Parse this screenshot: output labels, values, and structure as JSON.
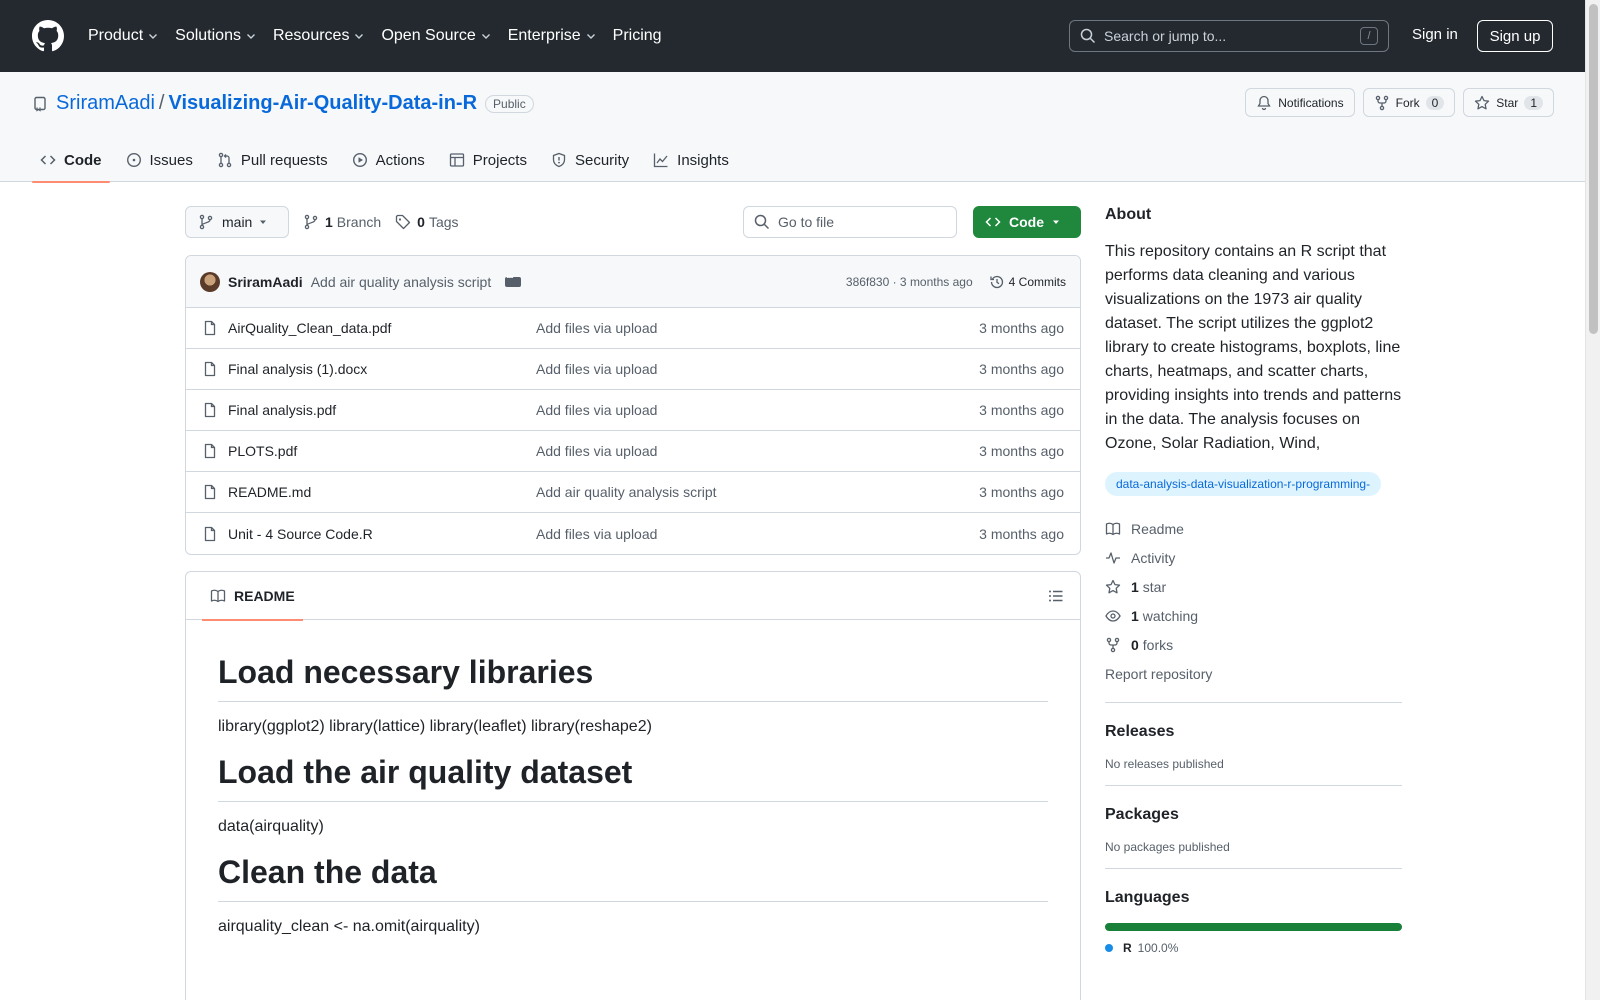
{
  "header": {
    "nav": [
      {
        "label": "Product",
        "has_menu": true
      },
      {
        "label": "Solutions",
        "has_menu": true
      },
      {
        "label": "Resources",
        "has_menu": true
      },
      {
        "label": "Open Source",
        "has_menu": true
      },
      {
        "label": "Enterprise",
        "has_menu": true
      },
      {
        "label": "Pricing",
        "has_menu": false
      }
    ],
    "search_placeholder": "Search or jump to...",
    "search_shortcut": "/",
    "sign_in": "Sign in",
    "sign_up": "Sign up"
  },
  "repo": {
    "owner": "SriramAadi",
    "separator": "/",
    "name": "Visualizing-Air-Quality-Data-in-R",
    "visibility": "Public",
    "notifications_label": "Notifications",
    "fork_label": "Fork",
    "fork_count": "0",
    "star_label": "Star",
    "star_count": "1"
  },
  "tabs": [
    {
      "label": "Code",
      "icon": "code-icon",
      "active": true
    },
    {
      "label": "Issues",
      "icon": "issue-icon",
      "active": false
    },
    {
      "label": "Pull requests",
      "icon": "pull-request-icon",
      "active": false
    },
    {
      "label": "Actions",
      "icon": "play-icon",
      "active": false
    },
    {
      "label": "Projects",
      "icon": "table-icon",
      "active": false
    },
    {
      "label": "Security",
      "icon": "shield-icon",
      "active": false
    },
    {
      "label": "Insights",
      "icon": "graph-icon",
      "active": false
    }
  ],
  "toolbar": {
    "branch": "main",
    "branch_count": "1",
    "branch_label": "Branch",
    "tag_count": "0",
    "tag_label": "Tags",
    "goto_placeholder": "Go to file",
    "code_button": "Code"
  },
  "commit": {
    "author": "SriramAadi",
    "message": "Add air quality analysis script",
    "meta": "386f830 · 3 months ago",
    "commits_label": "4 Commits"
  },
  "files": [
    {
      "name": "AirQuality_Clean_data.pdf",
      "message": "Add files via upload",
      "date": "3 months ago"
    },
    {
      "name": "Final analysis (1).docx",
      "message": "Add files via upload",
      "date": "3 months ago"
    },
    {
      "name": "Final analysis.pdf",
      "message": "Add files via upload",
      "date": "3 months ago"
    },
    {
      "name": "PLOTS.pdf",
      "message": "Add files via upload",
      "date": "3 months ago"
    },
    {
      "name": "README.md",
      "message": "Add air quality analysis script",
      "date": "3 months ago"
    },
    {
      "name": "Unit - 4 Source Code.R",
      "message": "Add files via upload",
      "date": "3 months ago"
    }
  ],
  "readme": {
    "tab_label": "README",
    "sections": [
      {
        "heading": "Load necessary libraries",
        "text": "library(ggplot2) library(lattice) library(leaflet) library(reshape2)"
      },
      {
        "heading": "Load the air quality dataset",
        "text": "data(airquality)"
      },
      {
        "heading": "Clean the data",
        "text": "airquality_clean <- na.omit(airquality)"
      }
    ]
  },
  "about": {
    "title": "About",
    "description": "This repository contains an R script that performs data cleaning and various visualizations on the 1973 air quality dataset. The script utilizes the ggplot2 library to create histograms, boxplots, line charts, heatmaps, and scatter charts, providing insights into trends and patterns in the data. The analysis focuses on Ozone, Solar Radiation, Wind,",
    "topic": "data-analysis-data-visualization-r-programming-",
    "readme_link": "Readme",
    "activity_link": "Activity",
    "stars_count": "1",
    "stars_label": "star",
    "watching_count": "1",
    "watching_label": "watching",
    "forks_count": "0",
    "forks_label": "forks",
    "report_link": "Report repository"
  },
  "releases": {
    "title": "Releases",
    "text": "No releases published"
  },
  "packages": {
    "title": "Packages",
    "text": "No packages published"
  },
  "languages": {
    "title": "Languages",
    "items": [
      {
        "name": "R",
        "percent": "100.0%",
        "fraction": 1.0,
        "color": "#198ce7"
      }
    ]
  }
}
